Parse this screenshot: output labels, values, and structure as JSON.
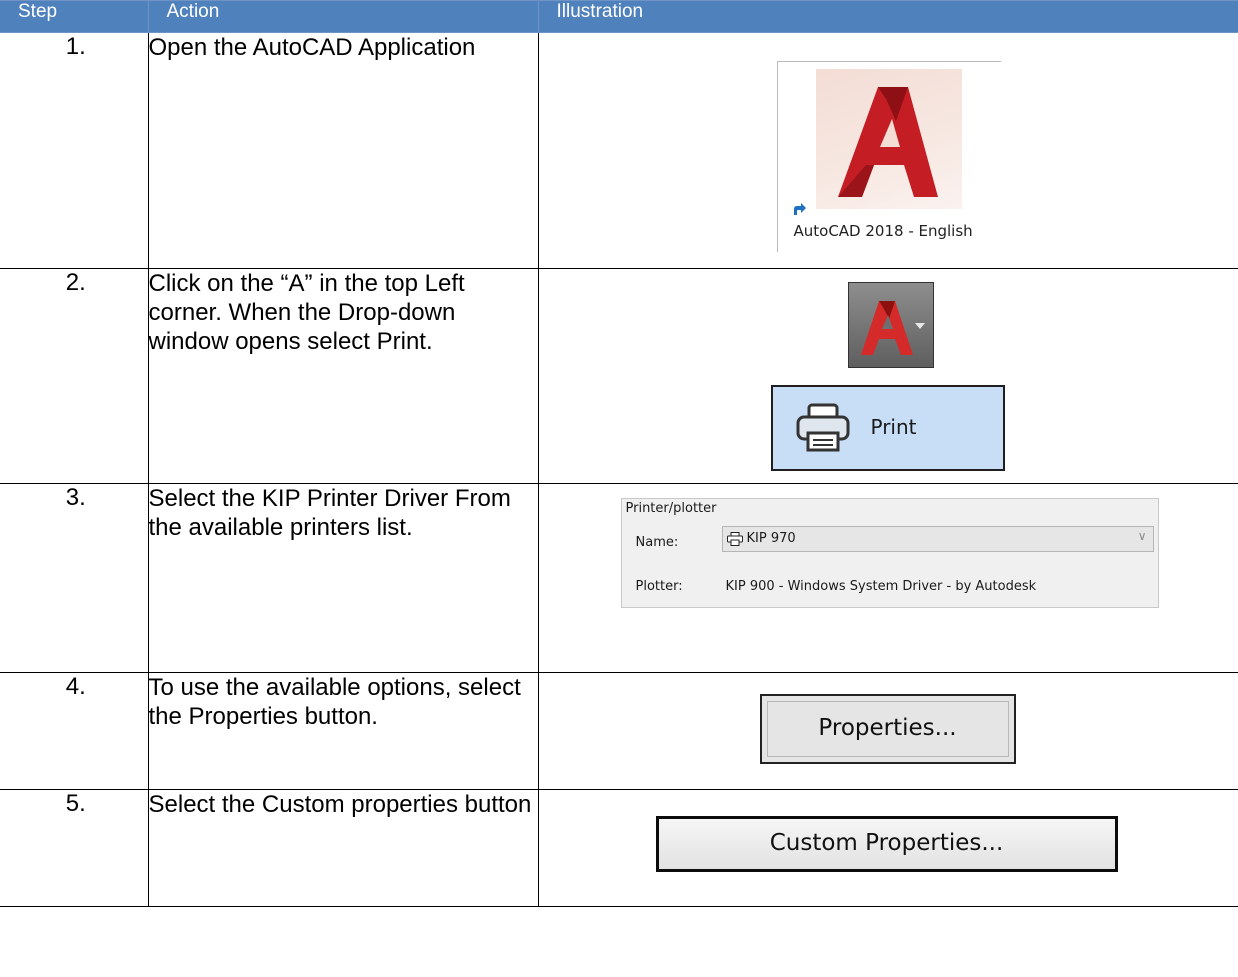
{
  "table": {
    "headers": [
      "Step",
      "Action",
      "Illustration"
    ],
    "rows": [
      {
        "step": "1.",
        "action": "Open the AutoCAD Application"
      },
      {
        "step": "2.",
        "action": "Click on the “A” in the top Left corner. When the Drop-down window opens select Print."
      },
      {
        "step": "3.",
        "action": "Select the KIP Printer Driver From the available printers list."
      },
      {
        "step": "4.",
        "action": "To use the available options, select the Properties button."
      },
      {
        "step": "5.",
        "action": "Select the Custom properties button"
      }
    ]
  },
  "illustrations": {
    "autocad_icon_caption": "AutoCAD 2018 - English",
    "print_button_label": "Print",
    "printer_panel": {
      "group_label": "Printer/plotter",
      "name_label": "Name:",
      "name_value": "KIP 970",
      "plotter_label": "Plotter:",
      "plotter_value": "KIP 900 - Windows System Driver - by Autodesk"
    },
    "properties_button_label": "Properties...",
    "custom_properties_button_label": "Custom Properties..."
  },
  "colors": {
    "header_bg": "#4f81bd",
    "header_text": "#ffffff",
    "autocad_red": "#c41e24",
    "print_button_bg": "#c7def6"
  }
}
